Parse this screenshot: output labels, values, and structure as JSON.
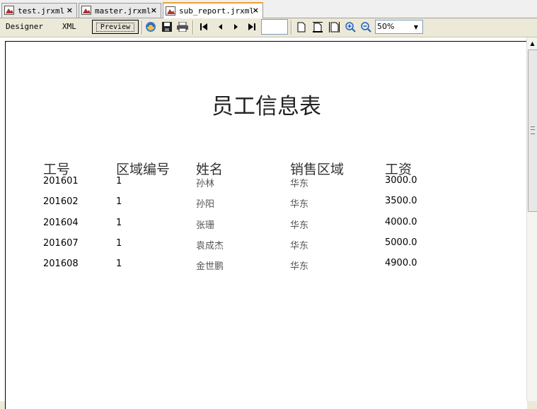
{
  "tabs": [
    {
      "label": "test.jrxml",
      "close": "×"
    },
    {
      "label": "master.jrxml",
      "close": "×"
    },
    {
      "label": "sub_report.jrxml",
      "close": "×"
    }
  ],
  "toolbar": {
    "designer_label": "Designer",
    "xml_label": "XML",
    "preview_label": "Preview",
    "page_value": "",
    "zoom_value": "50%"
  },
  "report": {
    "title": "员工信息表",
    "columns": [
      "工号",
      "区域编号",
      "姓名",
      "销售区域",
      "工资"
    ],
    "rows": [
      [
        "201601",
        "1",
        "孙林",
        "华东",
        "3000.0"
      ],
      [
        "201602",
        "1",
        "孙阳",
        "华东",
        "3500.0"
      ],
      [
        "201604",
        "1",
        "张珊",
        "华东",
        "4000.0"
      ],
      [
        "201607",
        "1",
        "袁成杰",
        "华东",
        "5000.0"
      ],
      [
        "201608",
        "1",
        "金世鹏",
        "华东",
        "4900.0"
      ]
    ]
  },
  "colors": {
    "accent_tab": "#f0a030",
    "border": "#7f9db9"
  }
}
